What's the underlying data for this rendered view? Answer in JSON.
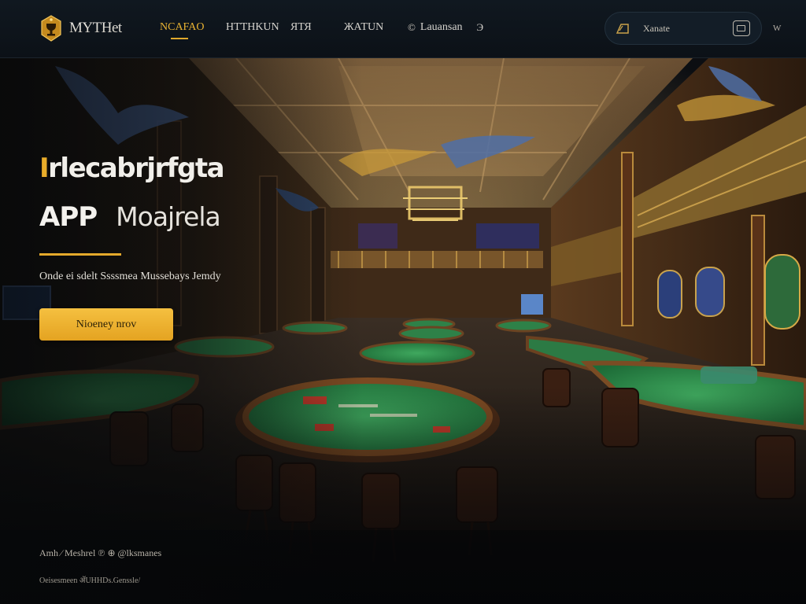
{
  "header": {
    "brand_name": "MYTHet",
    "brand_icon": "trophy-logo-icon",
    "nav": [
      {
        "label": "NCAFAO",
        "active": true
      },
      {
        "label": "HTTHKUN",
        "active": false
      },
      {
        "label": "ЯТЯ",
        "active": false
      },
      {
        "label": "ЖАТUN",
        "active": false
      }
    ],
    "language": {
      "glyph": "©",
      "label": "Lauansan",
      "extra": "Э"
    },
    "search": {
      "placeholder": "Xanate",
      "icon": "tag-icon",
      "button_icon": "card-icon"
    },
    "menu_label": "W"
  },
  "hero": {
    "title_line1": {
      "mark": "I",
      "rest": "rlecabrjrfgta"
    },
    "title_line2": {
      "strong": "APP",
      "light": "Moajrela"
    },
    "subtitle": "Onde ei sdelt Ssssmea Mussebays Jemdy",
    "cta_label": "Nioeney nrov",
    "footer_line1": "Amh ⁄ Meshrel ℗ ⊕ @lksmanes",
    "footer_line2": "Oeisesmeen  ॲUHHDs.Genssle/"
  },
  "colors": {
    "accent": "#e9ad2a",
    "topbar": "#101820",
    "felt_green": "#2f8a4a",
    "wood": "#4a2a16"
  }
}
